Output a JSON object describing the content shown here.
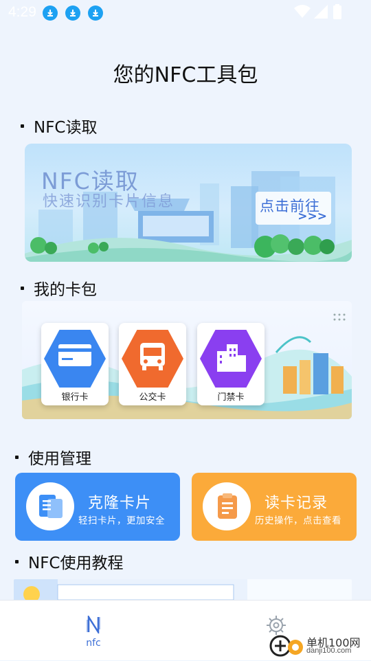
{
  "status_bar": {
    "time": "4:29",
    "icons": [
      "download-icon",
      "download-icon",
      "download-icon",
      "wifi-icon",
      "signal-icon",
      "battery-icon"
    ]
  },
  "page": {
    "title": "您的NFC工具包"
  },
  "sections": {
    "nfc_read": {
      "title": "NFC读取",
      "banner_title": "NFC读取",
      "banner_subtitle": "快速识别卡片信息",
      "button_label": "点击前往",
      "button_arrows": ">>>"
    },
    "wallet": {
      "title": "我的卡包",
      "cards": [
        {
          "label": "银行卡",
          "color": "#3a86f0",
          "icon": "bank-card-icon"
        },
        {
          "label": "公交卡",
          "color": "#f06a2e",
          "icon": "bus-icon"
        },
        {
          "label": "门禁卡",
          "color": "#8a3ff0",
          "icon": "building-icon"
        }
      ]
    },
    "management": {
      "title": "使用管理",
      "items": [
        {
          "title": "克隆卡片",
          "subtitle": "轻扫卡片，更加安全",
          "color": "#3d8ff6",
          "icon": "clone-card-icon"
        },
        {
          "title": "读卡记录",
          "subtitle": "历史操作，点击查看",
          "color": "#fbaa3a",
          "icon": "record-icon"
        }
      ]
    },
    "tutorial": {
      "title": "NFC使用教程"
    }
  },
  "bottom_nav": {
    "items": [
      {
        "label": "nfc",
        "icon": "nfc-icon",
        "active": true
      },
      {
        "label": "",
        "icon": "gear-icon",
        "active": false
      }
    ]
  },
  "watermark": {
    "text": "单机100网",
    "sub": "danji100.com"
  },
  "colors": {
    "accent": "#3d6fd6",
    "background": "#eef4fd"
  }
}
